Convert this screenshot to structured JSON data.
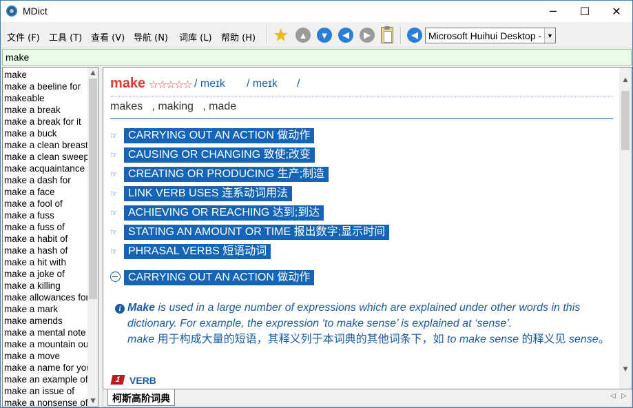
{
  "window": {
    "title": "MDict",
    "minimize_glyph": "─",
    "maximize_glyph": "☐",
    "close_glyph": "✕"
  },
  "menu": [
    "文件 (F)",
    "工具 (T)",
    "查看 (V)",
    "导航 (N)",
    "词库 (L)",
    "帮助 (H)"
  ],
  "toolbar": {
    "icons": [
      "star-icon",
      "up-icon",
      "down-icon",
      "back-icon",
      "forward-icon",
      "clipboard-icon",
      "speaker-back-icon"
    ],
    "dictionary_select": "Microsoft Huihui Desktop -"
  },
  "search": {
    "value": "make"
  },
  "word_list": [
    "make",
    "make a beeline for",
    "makeable",
    "make a break",
    "make a break for it",
    "make a buck",
    "make a clean breast",
    "make a clean sweep",
    "make acquaintance",
    "make a dash for",
    "make a face",
    "make a fool of",
    "make a fuss",
    "make a fuss of",
    "make a habit of",
    "make a hash of",
    "make a hit with",
    "make a joke of",
    "make a killing",
    "make allowances for",
    "make a mark",
    "make amends",
    "make a mental note",
    "make a mountain out",
    "make a move",
    "make a name for yourself",
    "make an example of",
    "make an issue of",
    "make a nonsense of"
  ],
  "entry": {
    "headword": "make",
    "stars": "☆☆☆☆☆",
    "pron1": "/ meɪk",
    "pron2": "/ meɪk",
    "pron3": "/",
    "forms": "makes   , making   , made",
    "sections": [
      "CARRYING OUT AN ACTION 做动作",
      "CAUSING OR CHANGING 致使;改变",
      "CREATING OR PRODUCING 生产;制造",
      "LINK VERB USES 连系动词用法",
      "ACHIEVING OR REACHING 达到;到达",
      "STATING AN AMOUNT OR TIME 报出数字;显示时间",
      "PHRASAL VERBS 短语动词"
    ],
    "expanded_section": "CARRYING OUT AN ACTION 做动作",
    "note": {
      "lead": "Make",
      "text1": " is used in a large number of expressions which are explained under other words in this dictionary. For example, the expression ‘to make sense’ is explained at ‘sense’.",
      "word2": "make",
      "cn1": " 用于构成大量的短语，其释义列于本词典的其他词条下，如 ",
      "phrase": "to make sense",
      "cn2": " 的释义见 ",
      "ref": "sense",
      "cn3": "。"
    },
    "sense_number": "1",
    "pos": "VERB"
  },
  "tabs": [
    "柯斯高阶词典"
  ],
  "tab_nav": {
    "prev": "◁",
    "next": "▷"
  }
}
